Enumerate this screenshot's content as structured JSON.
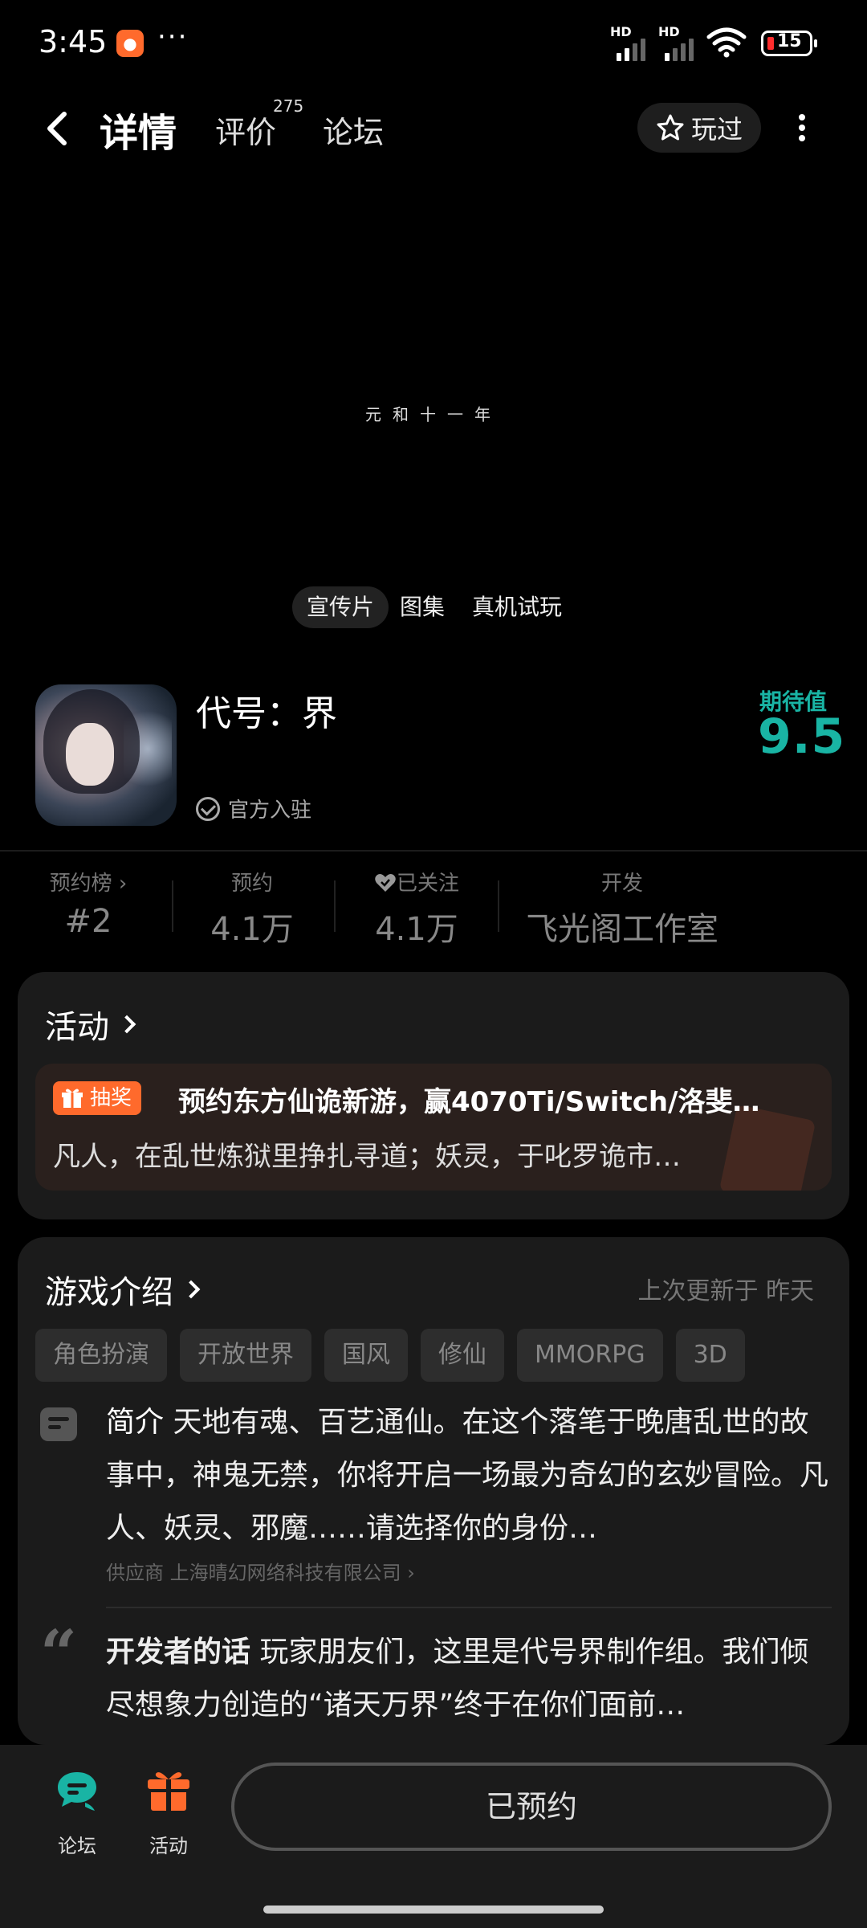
{
  "status_bar": {
    "time": "3:45",
    "signal1_label": "HD",
    "signal2_label": "HD",
    "battery": "15"
  },
  "nav": {
    "tab_detail": "详情",
    "tab_reviews": "评价",
    "reviews_count": "275",
    "tab_forum": "论坛",
    "played_label": "玩过"
  },
  "video": {
    "caption": "元和十一年",
    "tabs": [
      "宣传片",
      "图集",
      "真机试玩"
    ]
  },
  "game": {
    "title": "代号：界",
    "official_label": "官方入驻",
    "expect_label": "期待值",
    "expect_value": "9.5"
  },
  "stats": [
    {
      "label": "预约榜 ›",
      "value": "#2"
    },
    {
      "label": "预约",
      "value": "4.1万"
    },
    {
      "label": "已关注",
      "value": "4.1万"
    },
    {
      "label": "开发",
      "value": "飞光阁工作室"
    }
  ],
  "activity": {
    "title": "活动",
    "tag": "抽奖",
    "headline": "预约东方仙诡新游，赢4070Ti/Switch/洛斐…",
    "desc": "凡人，在乱世炼狱里挣扎寻道；妖灵，于叱罗诡市…"
  },
  "intro": {
    "title": "游戏介绍",
    "updated": "上次更新于 昨天",
    "tags": [
      "角色扮演",
      "开放世界",
      "国风",
      "修仙",
      "MMORPG",
      "3D"
    ],
    "summary_label": "简介",
    "summary": "天地有魂、百艺通仙。在这个落笔于晚唐乱世的故事中，神鬼无禁，你将开启一场最为奇幻的玄妙冒险。凡人、妖灵、邪魔……请选择你的身份…",
    "supplier": "供应商 上海晴幻网络科技有限公司 ›",
    "dev_label": "开发者的话",
    "dev_words": "玩家朋友们，这里是代号界制作组。我们倾尽想象力创造的“诸天万界”终于在你们面前…"
  },
  "bottom": {
    "forum_label": "论坛",
    "activity_label": "活动",
    "reserve_label": "已预约"
  },
  "colors": {
    "accent": "#19b4a4",
    "orange": "#ff6a2c"
  }
}
